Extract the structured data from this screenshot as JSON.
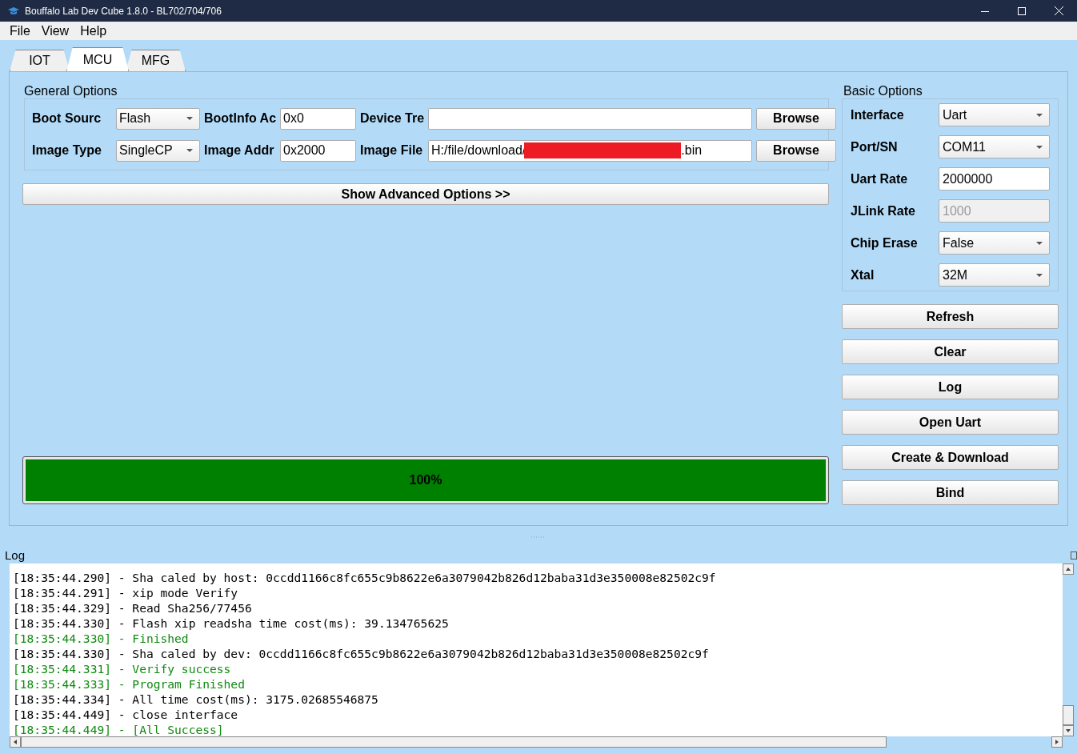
{
  "window": {
    "title": "Bouffalo Lab Dev Cube 1.8.0 - BL702/704/706"
  },
  "menu": [
    "File",
    "View",
    "Help"
  ],
  "tabs": [
    {
      "label": "IOT",
      "selected": false
    },
    {
      "label": "MCU",
      "selected": true
    },
    {
      "label": "MFG",
      "selected": false
    }
  ],
  "general_options": {
    "title": "General Options",
    "fields": [
      {
        "label": "Boot Sourc",
        "kind": "combo",
        "value": "Flash"
      },
      {
        "label": "BootInfo Ac",
        "kind": "text",
        "value": "0x0"
      },
      {
        "label": "Device Tre",
        "kind": "text",
        "button": "Browse"
      },
      {
        "label": "Image Type",
        "kind": "combo",
        "value": "SingleCP"
      },
      {
        "label": "Image Addr",
        "kind": "text",
        "value": "0x2000"
      },
      {
        "label": "Image File",
        "kind": "redacted",
        "value": "H:/file/download/",
        "suffix": ".bin",
        "button": "Browse"
      }
    ]
  },
  "advanced_button": "Show Advanced Options >>",
  "progress": {
    "level": 1,
    "text": "100%"
  },
  "basic_options": {
    "title": "Basic Options",
    "fields": [
      {
        "label": "Interface",
        "kind": "combo",
        "value": "Uart"
      },
      {
        "label": "Port/SN",
        "kind": "combo",
        "value": "COM11"
      },
      {
        "label": "Uart Rate",
        "kind": "text",
        "value": "2000000"
      },
      {
        "label": "JLink Rate",
        "kind": "disabled",
        "value": "1000"
      },
      {
        "label": "Chip Erase",
        "kind": "combo",
        "value": "False"
      },
      {
        "label": "Xtal",
        "kind": "combo",
        "value": "32M"
      }
    ]
  },
  "buttons": [
    "Refresh",
    "Clear",
    "Log",
    "Open Uart",
    "Create & Download",
    "Bind"
  ],
  "log": {
    "title": "Log",
    "lines": [
      {
        "kind": "info",
        "text": "[18:35:44.290] - Sha caled by host: 0ccdd1166c8fc655c9b8622e6a3079042b826d12baba31d3e350008e82502c9f"
      },
      {
        "kind": "info",
        "text": "[18:35:44.291] - xip mode Verify"
      },
      {
        "kind": "info",
        "text": "[18:35:44.329] - Read Sha256/77456"
      },
      {
        "kind": "info",
        "text": "[18:35:44.330] - Flash xip readsha time cost(ms): 39.134765625"
      },
      {
        "kind": "success",
        "text": "[18:35:44.330] - Finished"
      },
      {
        "kind": "info",
        "text": "[18:35:44.330] - Sha caled by dev: 0ccdd1166c8fc655c9b8622e6a3079042b826d12baba31d3e350008e82502c9f"
      },
      {
        "kind": "success",
        "text": "[18:35:44.331] - Verify success"
      },
      {
        "kind": "success",
        "text": "[18:35:44.333] - Program Finished"
      },
      {
        "kind": "info",
        "text": "[18:35:44.334] - All time cost(ms): 3175.02685546875"
      },
      {
        "kind": "info",
        "text": "[18:35:44.449] - close interface"
      },
      {
        "kind": "success",
        "text": "[18:35:44.449] - [All Success]"
      }
    ]
  }
}
